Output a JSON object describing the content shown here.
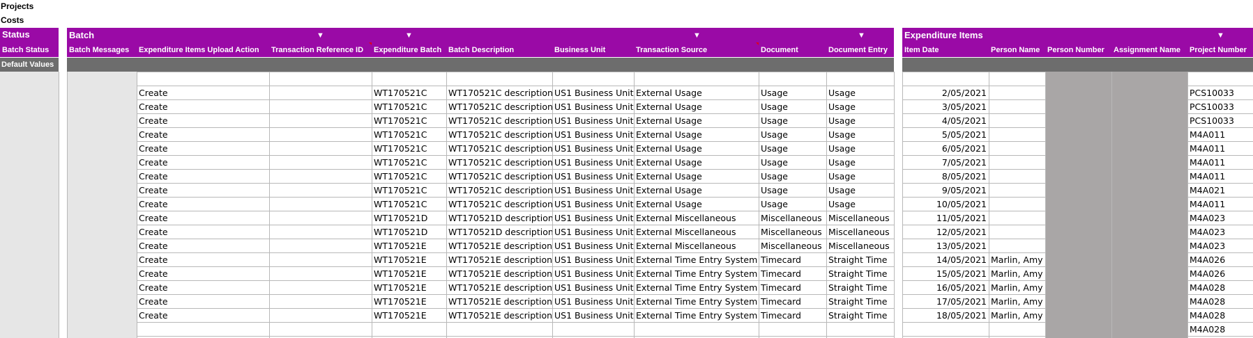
{
  "titles": [
    "Projects",
    "Costs"
  ],
  "status_band": {
    "title": "Status",
    "col_header": "Batch Status",
    "default_label": "Default Values"
  },
  "batch_band": {
    "title": "Batch",
    "headers": [
      "Batch Messages",
      "Expenditure Items Upload Action",
      "Transaction Reference ID",
      "Expenditure Batch",
      "Batch Description",
      "Business Unit",
      "Transaction Source",
      "Document",
      "Document Entry"
    ]
  },
  "items_band": {
    "title": "Expenditure Items",
    "headers": [
      "Item Date",
      "Person Name",
      "Person Number",
      "Assignment Name",
      "Project Number"
    ]
  },
  "filter_glyph": "▼",
  "colors": {
    "band": "#9a0aa6",
    "default_row": "#6d6d6d",
    "locked_cell": "#a9a6a6",
    "status_cell": "#e6e6e6",
    "grid": "#b8b8b8"
  },
  "rows": [
    {
      "action": "",
      "batch": "",
      "desc": "",
      "bu": "",
      "source": "",
      "document": "",
      "entry": "",
      "date": "",
      "person": "",
      "project": ""
    },
    {
      "action": "Create",
      "batch": "WT170521C",
      "desc": "WT170521C description",
      "bu": "US1 Business Unit",
      "source": "External Usage",
      "document": "Usage",
      "entry": "Usage",
      "date": "2/05/2021",
      "person": "",
      "project": "PCS10033"
    },
    {
      "action": "Create",
      "batch": "WT170521C",
      "desc": "WT170521C description",
      "bu": "US1 Business Unit",
      "source": "External Usage",
      "document": "Usage",
      "entry": "Usage",
      "date": "3/05/2021",
      "person": "",
      "project": "PCS10033"
    },
    {
      "action": "Create",
      "batch": "WT170521C",
      "desc": "WT170521C description",
      "bu": "US1 Business Unit",
      "source": "External Usage",
      "document": "Usage",
      "entry": "Usage",
      "date": "4/05/2021",
      "person": "",
      "project": "PCS10033"
    },
    {
      "action": "Create",
      "batch": "WT170521C",
      "desc": "WT170521C description",
      "bu": "US1 Business Unit",
      "source": "External Usage",
      "document": "Usage",
      "entry": "Usage",
      "date": "5/05/2021",
      "person": "",
      "project": "M4A011"
    },
    {
      "action": "Create",
      "batch": "WT170521C",
      "desc": "WT170521C description",
      "bu": "US1 Business Unit",
      "source": "External Usage",
      "document": "Usage",
      "entry": "Usage",
      "date": "6/05/2021",
      "person": "",
      "project": "M4A011"
    },
    {
      "action": "Create",
      "batch": "WT170521C",
      "desc": "WT170521C description",
      "bu": "US1 Business Unit",
      "source": "External Usage",
      "document": "Usage",
      "entry": "Usage",
      "date": "7/05/2021",
      "person": "",
      "project": "M4A011"
    },
    {
      "action": "Create",
      "batch": "WT170521C",
      "desc": "WT170521C description",
      "bu": "US1 Business Unit",
      "source": "External Usage",
      "document": "Usage",
      "entry": "Usage",
      "date": "8/05/2021",
      "person": "",
      "project": "M4A011"
    },
    {
      "action": "Create",
      "batch": "WT170521C",
      "desc": "WT170521C description",
      "bu": "US1 Business Unit",
      "source": "External Usage",
      "document": "Usage",
      "entry": "Usage",
      "date": "9/05/2021",
      "person": "",
      "project": "M4A021"
    },
    {
      "action": "Create",
      "batch": "WT170521C",
      "desc": "WT170521C description",
      "bu": "US1 Business Unit",
      "source": "External Usage",
      "document": "Usage",
      "entry": "Usage",
      "date": "10/05/2021",
      "person": "",
      "project": "M4A011"
    },
    {
      "action": "Create",
      "batch": "WT170521D",
      "desc": "WT170521D description",
      "bu": "US1 Business Unit",
      "source": "External Miscellaneous",
      "document": "Miscellaneous",
      "entry": "Miscellaneous",
      "date": "11/05/2021",
      "person": "",
      "project": "M4A023"
    },
    {
      "action": "Create",
      "batch": "WT170521D",
      "desc": "WT170521D description",
      "bu": "US1 Business Unit",
      "source": "External Miscellaneous",
      "document": "Miscellaneous",
      "entry": "Miscellaneous",
      "date": "12/05/2021",
      "person": "",
      "project": "M4A023"
    },
    {
      "action": "Create",
      "batch": "WT170521E",
      "desc": "WT170521E description",
      "bu": "US1 Business Unit",
      "source": "External Miscellaneous",
      "document": "Miscellaneous",
      "entry": "Miscellaneous",
      "date": "13/05/2021",
      "person": "",
      "project": "M4A023"
    },
    {
      "action": "Create",
      "batch": "WT170521E",
      "desc": "WT170521E description",
      "bu": "US1 Business Unit",
      "source": "External Time Entry System",
      "document": "Timecard",
      "entry": "Straight Time",
      "date": "14/05/2021",
      "person": "Marlin, Amy",
      "project": "M4A026"
    },
    {
      "action": "Create",
      "batch": "WT170521E",
      "desc": "WT170521E description",
      "bu": "US1 Business Unit",
      "source": "External Time Entry System",
      "document": "Timecard",
      "entry": "Straight Time",
      "date": "15/05/2021",
      "person": "Marlin, Amy",
      "project": "M4A026"
    },
    {
      "action": "Create",
      "batch": "WT170521E",
      "desc": "WT170521E description",
      "bu": "US1 Business Unit",
      "source": "External Time Entry System",
      "document": "Timecard",
      "entry": "Straight Time",
      "date": "16/05/2021",
      "person": "Marlin, Amy",
      "project": "M4A028"
    },
    {
      "action": "Create",
      "batch": "WT170521E",
      "desc": "WT170521E description",
      "bu": "US1 Business Unit",
      "source": "External Time Entry System",
      "document": "Timecard",
      "entry": "Straight Time",
      "date": "17/05/2021",
      "person": "Marlin, Amy",
      "project": "M4A028"
    },
    {
      "action": "Create",
      "batch": "WT170521E",
      "desc": "WT170521E description",
      "bu": "US1 Business Unit",
      "source": "External Time Entry System",
      "document": "Timecard",
      "entry": "Straight Time",
      "date": "18/05/2021",
      "person": "Marlin, Amy",
      "project": "M4A028"
    },
    {
      "action": "",
      "batch": "",
      "desc": "",
      "bu": "",
      "source": "",
      "document": "",
      "entry": "",
      "date": "",
      "person": "",
      "project": "M4A028"
    }
  ]
}
